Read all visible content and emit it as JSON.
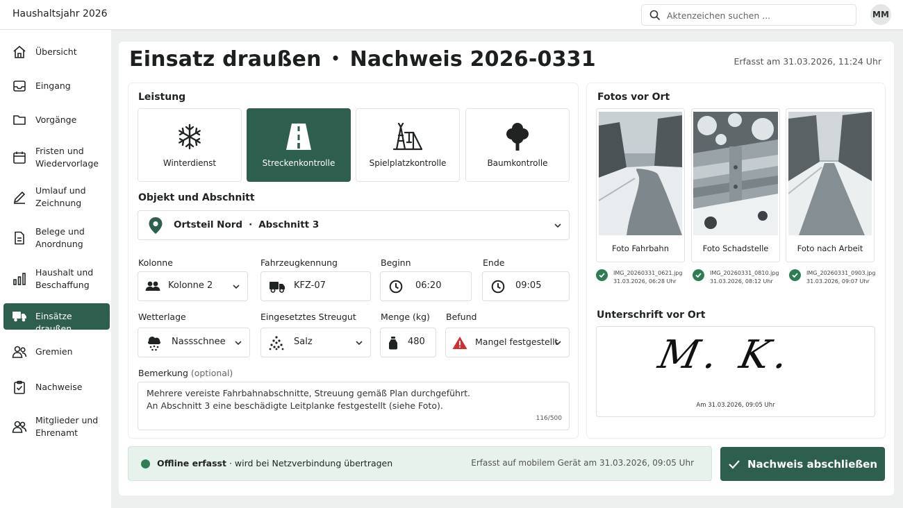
{
  "app": {
    "title": "Haushaltsjahr 2026"
  },
  "search": {
    "placeholder": "Aktenzeichen suchen ..."
  },
  "user": {
    "initials": "MM"
  },
  "sidebar": {
    "items": [
      {
        "label": "Übersicht",
        "icon": "home-icon"
      },
      {
        "label": "Eingang",
        "icon": "inbox-icon"
      },
      {
        "label": "Vorgänge",
        "icon": "folder-icon"
      },
      {
        "label": "Fristen und\nWiedervorlage",
        "icon": "calendar-icon"
      },
      {
        "label": "Umlauf und\nZeichnung",
        "icon": "pen-icon"
      },
      {
        "label": "Belege und\nAnordnung",
        "icon": "document-icon"
      },
      {
        "label": "Haushalt und\nBeschaffung",
        "icon": "bar-chart-icon"
      },
      {
        "label": "Einsätze draußen",
        "icon": "truck-icon",
        "active": true
      },
      {
        "label": "Gremien",
        "icon": "group-icon"
      },
      {
        "label": "Nachweise",
        "icon": "clipboard-check-icon"
      },
      {
        "label": "Mitglieder und\nEhrenamt",
        "icon": "members-icon"
      }
    ]
  },
  "page": {
    "title": "Einsatz draußen",
    "separator": "•",
    "record": "Nachweis 2026-0331",
    "captured": "Erfasst am 31.03.2026, 11:24 Uhr"
  },
  "service": {
    "heading": "Leistung",
    "options": [
      {
        "label": "Winterdienst",
        "icon": "snowflake-icon"
      },
      {
        "label": "Streckenkontrolle",
        "icon": "road-icon",
        "selected": true
      },
      {
        "label": "Spielplatzkontrolle",
        "icon": "playground-icon"
      },
      {
        "label": "Baumkontrolle",
        "icon": "tree-icon"
      }
    ]
  },
  "object": {
    "heading": "Objekt und Abschnitt",
    "district": "Ortsteil Nord",
    "dot": "·",
    "section": "Abschnitt 3"
  },
  "fields": {
    "kolonne": {
      "label": "Kolonne",
      "value": "Kolonne 2"
    },
    "fahrzeug": {
      "label": "Fahrzeugkennung",
      "value": "KFZ-07"
    },
    "beginn": {
      "label": "Beginn",
      "value": "06:20"
    },
    "ende": {
      "label": "Ende",
      "value": "09:05"
    },
    "wetter": {
      "label": "Wetterlage",
      "value": "Nassschnee"
    },
    "streugut": {
      "label": "Eingesetztes Streugut",
      "value": "Salz"
    },
    "menge": {
      "label": "Menge (kg)",
      "value": "480"
    },
    "befund": {
      "label": "Befund",
      "value": "Mangel festgestellt"
    }
  },
  "remark": {
    "label": "Bemerkung",
    "optional": "(optional)",
    "line1": "Mehrere vereiste Fahrbahnabschnitte,  Streuung gemäß Plan durchgeführt.",
    "line2": "An Abschnitt 3 eine beschädigte Leitplanke festgestellt (siehe Foto).",
    "counter": "116/500"
  },
  "photos": {
    "heading": "Fotos vor Ort",
    "items": [
      {
        "label": "Foto Fahrbahn",
        "file": "IMG_20260331_0621.jpg",
        "time": "31.03.2026, 06:28 Uhr"
      },
      {
        "label": "Foto Schadstelle",
        "file": "IMG_20260331_0810.jpg",
        "time": "31.03.2026, 08:12 Uhr"
      },
      {
        "label": "Foto nach Arbeit",
        "file": "IMG_20260331_0903.jpg",
        "time": "31.03.2026, 09:07 Uhr"
      }
    ]
  },
  "signature": {
    "heading": "Unterschrift vor Ort",
    "text": "M. K.",
    "date": "Am 31.03.2026, 09:05 Uhr"
  },
  "status": {
    "bold": "Offline erfasst",
    "rest": " · wird bei Netzverbindung übertragen",
    "device": "Erfasst auf mobilem Gerät am 31.03.2026, 09:05 Uhr"
  },
  "submit": {
    "label": "Nachweis abschließen"
  },
  "colors": {
    "accent": "#2e5e4e",
    "success": "#2e7d55",
    "warning": "#d32f2f"
  }
}
